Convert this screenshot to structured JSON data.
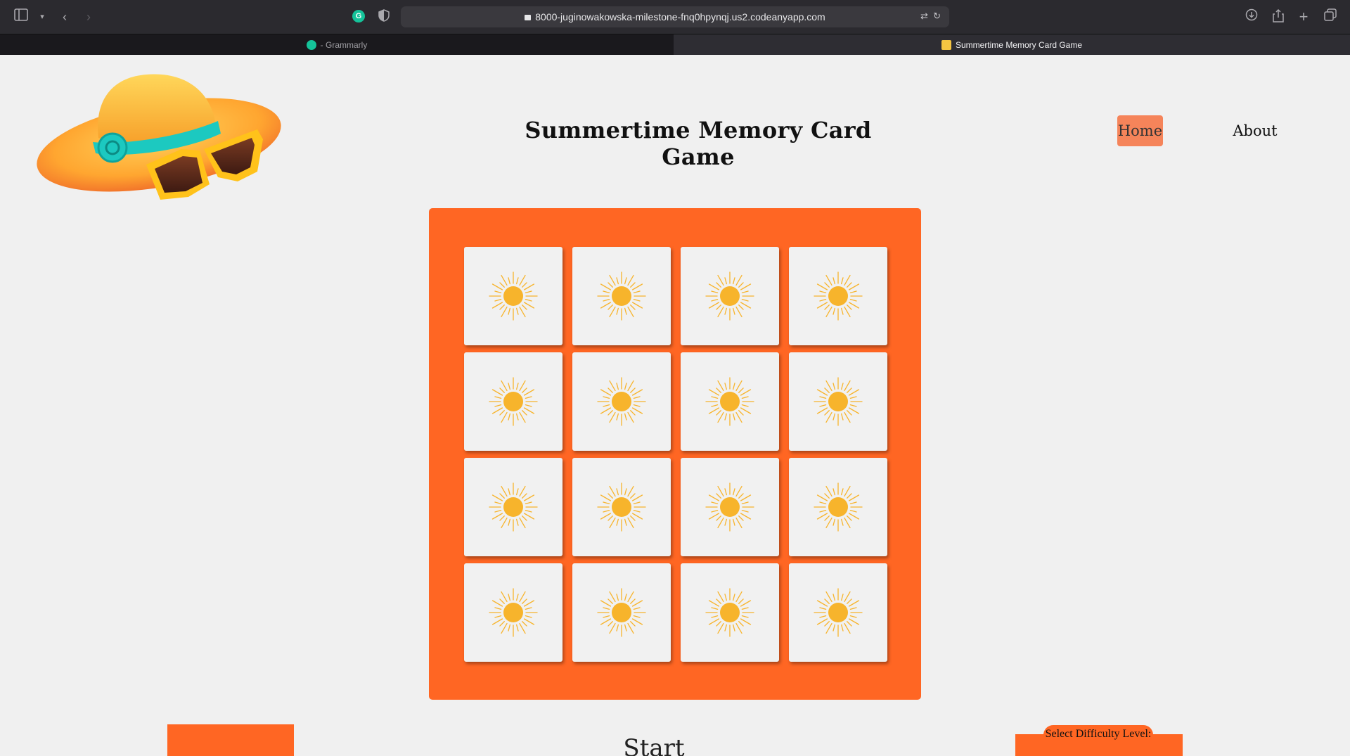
{
  "browser": {
    "url": "8000-juginowakowska-milestone-fnq0hpynqj.us2.codeanyapp.com",
    "tabs": [
      {
        "title": "- Grammarly",
        "active": false
      },
      {
        "title": "Summertime Memory Card Game",
        "active": true
      }
    ],
    "icons": {
      "sidebar": "sidebar-icon",
      "back": "chevron-left-icon",
      "forward": "chevron-right-icon",
      "download": "download-icon",
      "share": "share-icon",
      "new_tab": "plus-icon",
      "tab_overview": "tabs-icon"
    }
  },
  "header": {
    "title": "Summertime Memory Card Game",
    "nav": {
      "home": "Home",
      "about": "About"
    }
  },
  "game": {
    "rows": 4,
    "columns": 4,
    "card_back": "sun-icon"
  },
  "controls": {
    "start_label": "Start",
    "difficulty_label": "Select Difficulty Level:"
  },
  "colors": {
    "accent": "#ff6623",
    "nav_active": "#f5845a",
    "background": "#f0f0f0",
    "card": "#f1f1f1",
    "sun": "#f7b42c"
  }
}
